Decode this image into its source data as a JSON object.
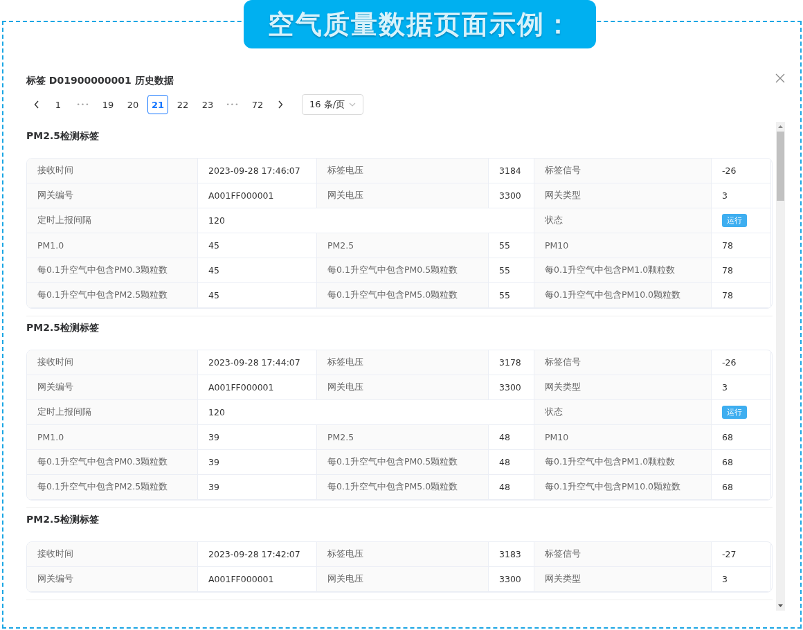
{
  "banner": {
    "title": "空气质量数据页面示例："
  },
  "dialog": {
    "title": "标签 D01900000001 历史数据"
  },
  "pagination": {
    "pages": [
      {
        "label": "1",
        "kind": "page",
        "selected": false
      },
      {
        "label": "•••",
        "kind": "ellipsis",
        "selected": false
      },
      {
        "label": "19",
        "kind": "page",
        "selected": false
      },
      {
        "label": "20",
        "kind": "page",
        "selected": false
      },
      {
        "label": "21",
        "kind": "page",
        "selected": true
      },
      {
        "label": "22",
        "kind": "page",
        "selected": false
      },
      {
        "label": "23",
        "kind": "page",
        "selected": false
      },
      {
        "label": "•••",
        "kind": "ellipsis",
        "selected": false
      },
      {
        "label": "72",
        "kind": "page",
        "selected": false
      }
    ],
    "page_size": "16 条/页"
  },
  "records": [
    {
      "title": "PM2.5检测标签",
      "rows": [
        [
          {
            "label": "接收时间",
            "value": "2023-09-28 17:46:07",
            "kind": "text"
          },
          {
            "label": "标签电压",
            "value": "3184",
            "kind": "text"
          },
          {
            "label": "标签信号",
            "value": "-26",
            "kind": "text"
          }
        ],
        [
          {
            "label": "网关编号",
            "value": "A001FF000001",
            "kind": "text"
          },
          {
            "label": "网关电压",
            "value": "3300",
            "kind": "text"
          },
          {
            "label": "网关类型",
            "value": "3",
            "kind": "text"
          }
        ],
        [
          {
            "label": "定时上报间隔",
            "value": "120",
            "kind": "wide"
          },
          {
            "kind": "empty"
          },
          {
            "label": "状态",
            "value": "运行",
            "kind": "badge"
          }
        ],
        [
          {
            "label": "PM1.0",
            "value": "45",
            "kind": "text"
          },
          {
            "label": "PM2.5",
            "value": "55",
            "kind": "text"
          },
          {
            "label": "PM10",
            "value": "78",
            "kind": "text"
          }
        ],
        [
          {
            "label": "每0.1升空气中包含PM0.3颗粒数",
            "value": "45",
            "kind": "text"
          },
          {
            "label": "每0.1升空气中包含PM0.5颗粒数",
            "value": "55",
            "kind": "text"
          },
          {
            "label": "每0.1升空气中包含PM1.0颗粒数",
            "value": "78",
            "kind": "text"
          }
        ],
        [
          {
            "label": "每0.1升空气中包含PM2.5颗粒数",
            "value": "45",
            "kind": "text"
          },
          {
            "label": "每0.1升空气中包含PM5.0颗粒数",
            "value": "55",
            "kind": "text"
          },
          {
            "label": "每0.1升空气中包含PM10.0颗粒数",
            "value": "78",
            "kind": "text"
          }
        ]
      ]
    },
    {
      "title": "PM2.5检测标签",
      "rows": [
        [
          {
            "label": "接收时间",
            "value": "2023-09-28 17:44:07",
            "kind": "text"
          },
          {
            "label": "标签电压",
            "value": "3178",
            "kind": "text"
          },
          {
            "label": "标签信号",
            "value": "-26",
            "kind": "text"
          }
        ],
        [
          {
            "label": "网关编号",
            "value": "A001FF000001",
            "kind": "text"
          },
          {
            "label": "网关电压",
            "value": "3300",
            "kind": "text"
          },
          {
            "label": "网关类型",
            "value": "3",
            "kind": "text"
          }
        ],
        [
          {
            "label": "定时上报间隔",
            "value": "120",
            "kind": "wide"
          },
          {
            "kind": "empty"
          },
          {
            "label": "状态",
            "value": "运行",
            "kind": "badge"
          }
        ],
        [
          {
            "label": "PM1.0",
            "value": "39",
            "kind": "text"
          },
          {
            "label": "PM2.5",
            "value": "48",
            "kind": "text"
          },
          {
            "label": "PM10",
            "value": "68",
            "kind": "text"
          }
        ],
        [
          {
            "label": "每0.1升空气中包含PM0.3颗粒数",
            "value": "39",
            "kind": "text"
          },
          {
            "label": "每0.1升空气中包含PM0.5颗粒数",
            "value": "48",
            "kind": "text"
          },
          {
            "label": "每0.1升空气中包含PM1.0颗粒数",
            "value": "68",
            "kind": "text"
          }
        ],
        [
          {
            "label": "每0.1升空气中包含PM2.5颗粒数",
            "value": "39",
            "kind": "text"
          },
          {
            "label": "每0.1升空气中包含PM5.0颗粒数",
            "value": "48",
            "kind": "text"
          },
          {
            "label": "每0.1升空气中包含PM10.0颗粒数",
            "value": "68",
            "kind": "text"
          }
        ]
      ]
    },
    {
      "title": "PM2.5检测标签",
      "rows": [
        [
          {
            "label": "接收时间",
            "value": "2023-09-28 17:42:07",
            "kind": "text"
          },
          {
            "label": "标签电压",
            "value": "3183",
            "kind": "text"
          },
          {
            "label": "标签信号",
            "value": "-27",
            "kind": "text"
          }
        ],
        [
          {
            "label": "网关编号",
            "value": "A001FF000001",
            "kind": "text"
          },
          {
            "label": "网关电压",
            "value": "3300",
            "kind": "text"
          },
          {
            "label": "网关类型",
            "value": "3",
            "kind": "text"
          }
        ]
      ]
    }
  ]
}
